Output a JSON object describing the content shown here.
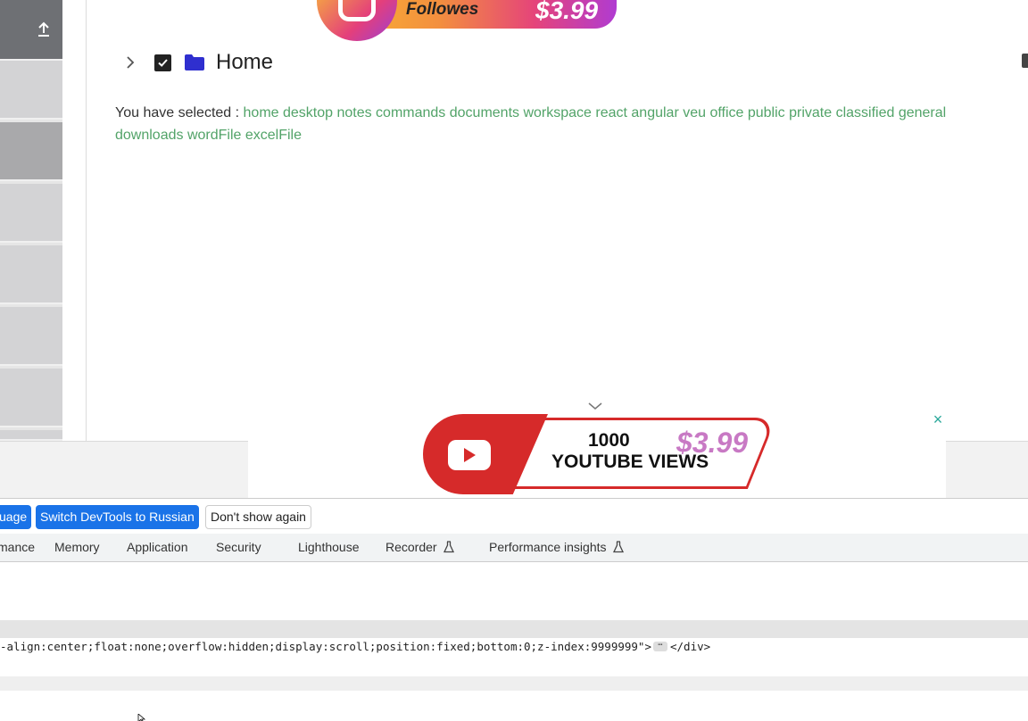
{
  "ads": {
    "instagram": {
      "text": "Followes",
      "price": "$3.99"
    },
    "youtube": {
      "line1": "1000",
      "line2": "YOUTUBE VIEWS",
      "price": "$3.99",
      "close": "×"
    }
  },
  "tree": {
    "label": "Home",
    "checked": true
  },
  "selection": {
    "prefix": "You have selected : ",
    "items": "home desktop notes commands documents workspace react angular veu office public private classified general downloads wordFile excelFile"
  },
  "devtools": {
    "language_bar": {
      "btn_language": "uage",
      "btn_switch": "Switch DevTools to Russian",
      "btn_dismiss": "Don't show again"
    },
    "tabs": [
      {
        "label": "mance"
      },
      {
        "label": "Memory"
      },
      {
        "label": "Application"
      },
      {
        "label": "Security"
      },
      {
        "label": "Lighthouse"
      },
      {
        "label": "Recorder"
      },
      {
        "label": "Performance insights"
      }
    ],
    "code_line": "-align:center;float:none;overflow:hidden;display:scroll;position:fixed;bottom:0;z-index:9999999\">",
    "code_end": "</div>",
    "ellipsis": "⋯"
  },
  "colors": {
    "accent": "#1a73e8",
    "selected_items": "#52a368",
    "folder": "#2f2fcf"
  }
}
